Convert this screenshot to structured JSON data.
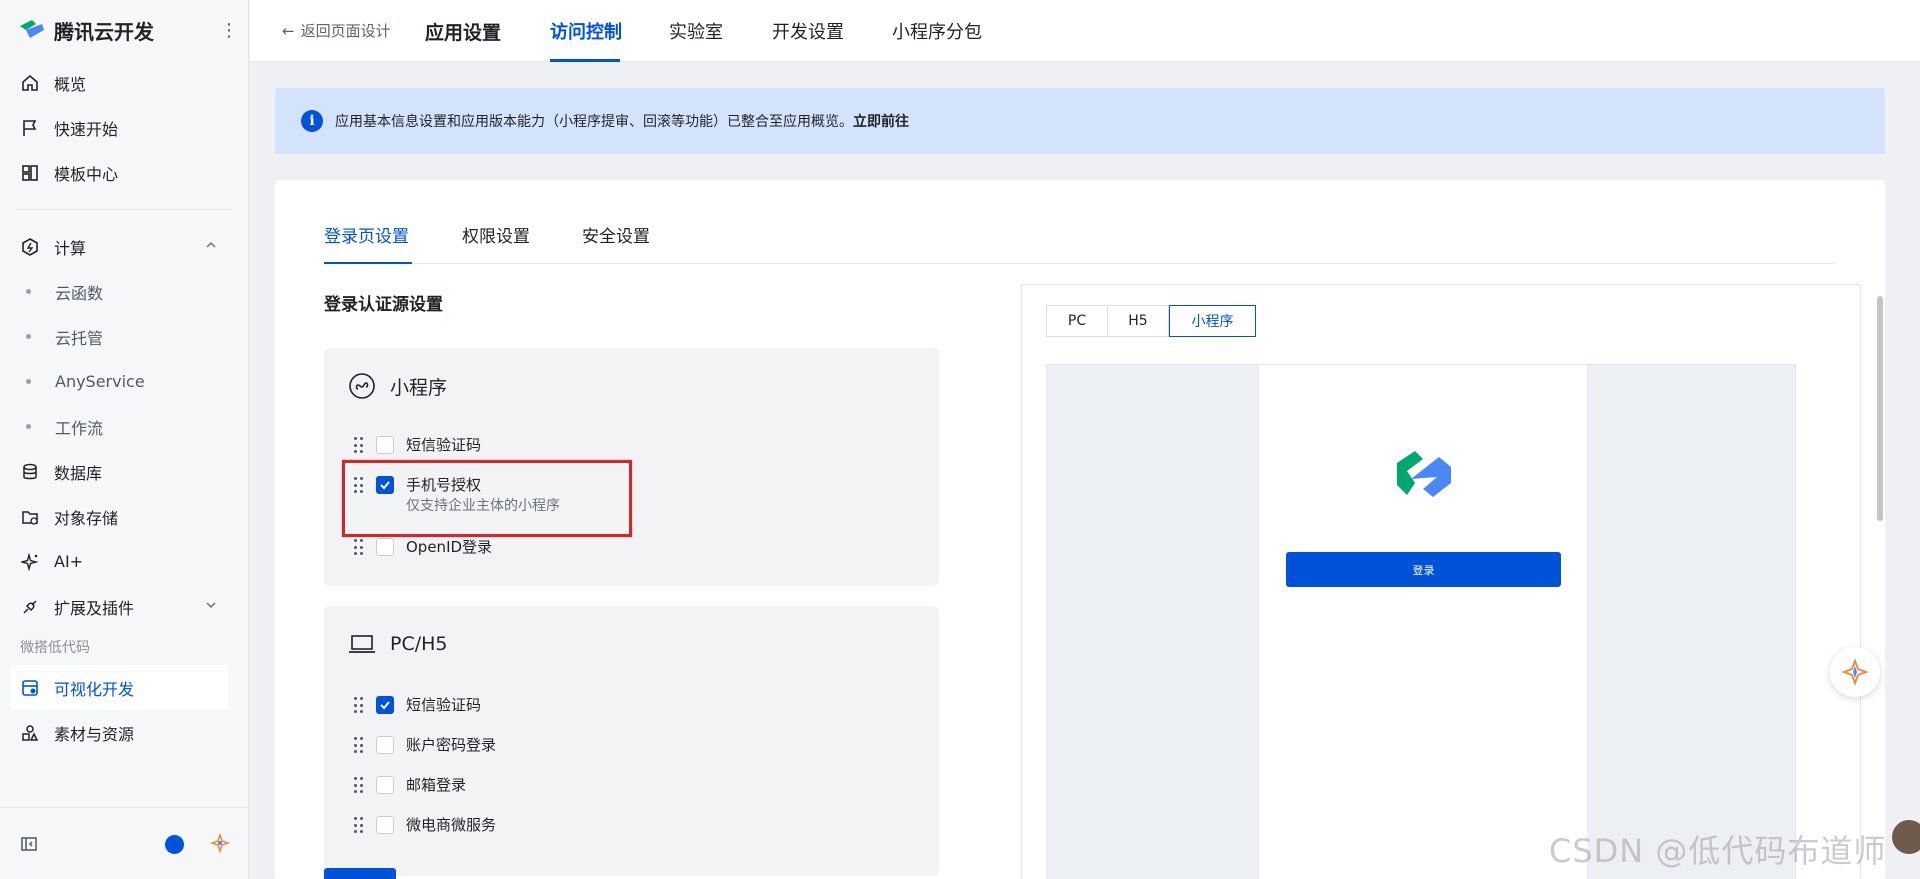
{
  "brand": {
    "name": "腾讯云开发"
  },
  "sidebar": {
    "items": [
      {
        "label": "概览",
        "icon": "home-icon"
      },
      {
        "label": "快速开始",
        "icon": "flag-icon"
      },
      {
        "label": "模板中心",
        "icon": "template-icon"
      }
    ],
    "compute": {
      "label": "计算",
      "icon": "compute-icon",
      "expanded": true
    },
    "compute_children": [
      "云函数",
      "云托管",
      "AnyService",
      "工作流"
    ],
    "items2": [
      {
        "label": "数据库",
        "icon": "database-icon"
      },
      {
        "label": "对象存储",
        "icon": "storage-icon"
      },
      {
        "label": "AI+",
        "icon": "sparkle-icon"
      },
      {
        "label": "扩展及插件",
        "icon": "plugin-icon"
      }
    ],
    "group_label": "微搭低代码",
    "lowcode_items": [
      {
        "label": "可视化开发",
        "icon": "visual-dev-icon",
        "active": true
      },
      {
        "label": "素材与资源",
        "icon": "assets-icon"
      }
    ]
  },
  "header": {
    "back_label": "返回页面设计",
    "tabs": [
      "应用设置",
      "访问控制",
      "实验室",
      "开发设置",
      "小程序分包"
    ],
    "active_tab": "访问控制"
  },
  "banner": {
    "text": "应用基本信息设置和应用版本能力（小程序提审、回滚等功能）已整合至应用概览。",
    "link": "立即前往"
  },
  "content_tabs": [
    "登录页设置",
    "权限设置",
    "安全设置"
  ],
  "section_title": "登录认证源设置",
  "miniprogram_group": {
    "title": "小程序",
    "options": [
      {
        "label": "短信验证码",
        "checked": false,
        "hint": ""
      },
      {
        "label": "手机号授权",
        "checked": true,
        "hint": "仅支持企业主体的小程序"
      },
      {
        "label": "OpenID登录",
        "checked": false,
        "hint": ""
      }
    ]
  },
  "pc_group": {
    "title": "PC/H5",
    "options": [
      {
        "label": "短信验证码",
        "checked": true
      },
      {
        "label": "账户密码登录",
        "checked": false
      },
      {
        "label": "邮箱登录",
        "checked": false
      },
      {
        "label": "微电商微服务",
        "checked": false
      }
    ]
  },
  "preview": {
    "platforms": [
      "PC",
      "H5",
      "小程序"
    ],
    "active_platform": "小程序",
    "login_button": "登录"
  },
  "watermark": "CSDN @低代码布道师",
  "colors": {
    "accent": "#0052d9",
    "highlight": "#d0282b",
    "banner_bg": "#d4e3fc"
  }
}
